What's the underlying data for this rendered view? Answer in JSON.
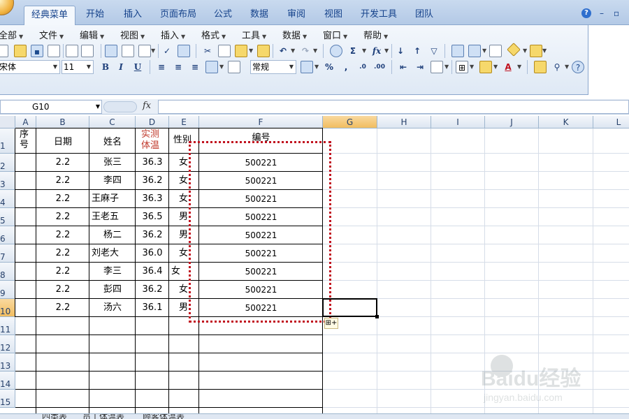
{
  "ribbon_tabs": [
    "经典菜单",
    "开始",
    "插入",
    "页面布局",
    "公式",
    "数据",
    "审阅",
    "视图",
    "开发工具",
    "团队"
  ],
  "window_controls": {
    "help": "?",
    "minimize": "–",
    "restore": "▫"
  },
  "classic_menus": [
    "全部",
    "文件",
    "编辑",
    "视图",
    "插入",
    "格式",
    "工具",
    "数据",
    "窗口",
    "帮助"
  ],
  "toolbar": {
    "font_name": "宋体",
    "font_size": "11",
    "bold": "B",
    "italic": "I",
    "underline": "U",
    "number_format": "常规",
    "sum_symbol": "Σ",
    "function_symbol": "fx",
    "percent": "%",
    "comma": ",",
    "font_color_letter": "A"
  },
  "formula_bar": {
    "name_box": "G10",
    "fx_label": "fx",
    "formula": ""
  },
  "columns": [
    "A",
    "B",
    "C",
    "D",
    "E",
    "F",
    "G",
    "H",
    "I",
    "J",
    "K",
    "L"
  ],
  "selected_column": "G",
  "row_numbers": [
    "1",
    "2",
    "3",
    "4",
    "5",
    "6",
    "7",
    "8",
    "9",
    "10",
    "11",
    "12",
    "13",
    "14",
    "15"
  ],
  "selected_row": "10",
  "headers": {
    "seq": "序\n号",
    "date": "日期",
    "name": "姓名",
    "temp_line1": "实测",
    "temp_line2": "体温",
    "gender": "性别",
    "code": "编号"
  },
  "rows": [
    {
      "date": "2.2",
      "name": "张三",
      "temp": "36.3",
      "gender": "女",
      "code": "500221"
    },
    {
      "date": "2.2",
      "name": "李四",
      "temp": "36.2",
      "gender": "女",
      "code": "500221"
    },
    {
      "date": "2.2",
      "name": "王麻子",
      "temp": "36.3",
      "gender": "女",
      "code": "500221"
    },
    {
      "date": "2.2",
      "name": "王老五",
      "temp": "36.5",
      "gender": "男",
      "code": "500221"
    },
    {
      "date": "2.2",
      "name": "杨二",
      "temp": "36.2",
      "gender": "男",
      "code": "500221"
    },
    {
      "date": "2.2",
      "name": "刘老大",
      "temp": "36.0",
      "gender": "女",
      "code": "500221"
    },
    {
      "date": "2.2",
      "name": "李三",
      "temp": "36.4",
      "gender": "女",
      "code": "500221"
    },
    {
      "date": "2.2",
      "name": "彭四",
      "temp": "36.2",
      "gender": "女",
      "code": "500221"
    },
    {
      "date": "2.2",
      "name": "汤六",
      "temp": "36.1",
      "gender": "男",
      "code": "500221"
    }
  ],
  "sheet_tabs": [
    "四类表",
    "员工体温表",
    "顾客体温表"
  ],
  "watermark": {
    "logo_text": "Bai du 经验",
    "url": "jingyan.baidu.com"
  },
  "colors": {
    "header_red": "#c0392b",
    "marquee": "#c1121f",
    "selection": "#000000"
  }
}
